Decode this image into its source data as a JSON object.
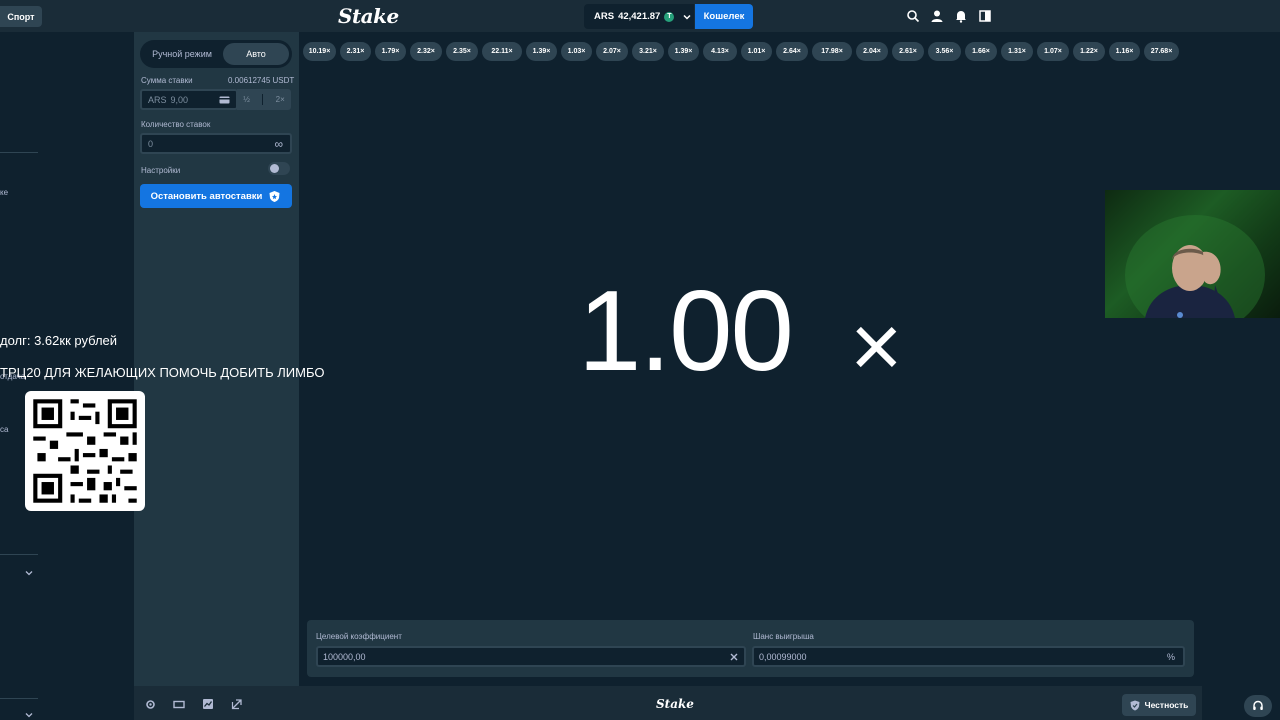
{
  "header": {
    "sport_label": "Спорт",
    "logo": "Stake",
    "balance_currency": "ARS",
    "balance_amount": "42,421.87",
    "coin_symbol": "T",
    "wallet_label": "Кошелек"
  },
  "sidebar": {
    "fragments": [
      "ке",
      "отдача",
      "са"
    ]
  },
  "bet_panel": {
    "tabs": [
      {
        "label": "Ручной режим",
        "active": false
      },
      {
        "label": "Авто",
        "active": true
      }
    ],
    "bet_amount_label": "Сумма ставки",
    "bet_amount_usdt": "0.00612745 USDT",
    "bet_currency": "ARS",
    "bet_value": "9,00",
    "half_label": "½",
    "double_label": "2×",
    "bets_count_label": "Количество ставок",
    "bets_count_value": "0",
    "infinity": "∞",
    "settings_label": "Настройки",
    "stop_button": "Остановить автоставки"
  },
  "history": [
    "10.19×",
    "2.31×",
    "1.79×",
    "2.32×",
    "2.35×",
    "22.11×",
    "1.39×",
    "1.03×",
    "2.07×",
    "3.21×",
    "1.39×",
    "4.13×",
    "1.01×",
    "2.64×",
    "17.98×",
    "2.04×",
    "2.61×",
    "3.56×",
    "1.66×",
    "1.31×",
    "1.07×",
    "1.22×",
    "1.16×",
    "27.68×"
  ],
  "result": {
    "multiplier": "1.00",
    "suffix": "×"
  },
  "controls": {
    "target_label": "Целевой коэффициент",
    "target_value": "100000,00",
    "win_chance_label": "Шанс выигрыша",
    "win_chance_value": "0,00099000",
    "percent": "%"
  },
  "footer": {
    "logo": "Stake",
    "fairness_label": "Честность"
  },
  "overlay": {
    "debt_text": "долг: 3.62кк рублей",
    "promo_text": "ТРЦ20 ДЛЯ ЖЕЛАЮЩИХ ПОМОЧЬ ДОБИТЬ ЛИМБО"
  },
  "colors": {
    "accent": "#1475e1",
    "bg_dark": "#0f212e",
    "panel": "#213743",
    "pill": "#2f4553",
    "usdt": "#26a17b"
  }
}
